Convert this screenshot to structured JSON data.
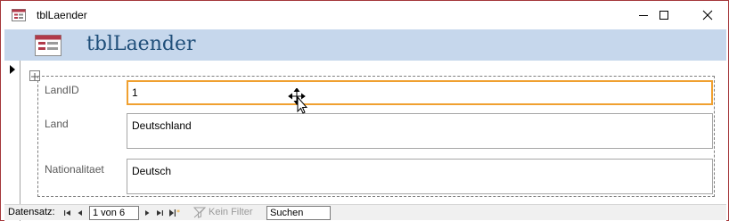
{
  "window": {
    "title": "tblLaender",
    "icon": "table-form-icon",
    "controls": [
      "minimize",
      "maximize",
      "close"
    ]
  },
  "header": {
    "title": "tblLaender",
    "icon": "table-form-icon"
  },
  "fields": [
    {
      "label": "LandID",
      "value": "1",
      "active": true
    },
    {
      "label": "Land",
      "value": "Deutschland",
      "active": false
    },
    {
      "label": "Nationalitaet",
      "value": "Deutsch",
      "active": false
    }
  ],
  "navigation": {
    "label": "Datensatz:",
    "record": "1 von 6",
    "filter_label": "Kein Filter",
    "search_placeholder": "Suchen"
  },
  "colors": {
    "header_band": "#c6d7ec",
    "header_title": "#1f4e79",
    "active_border": "#f0a030",
    "window_border": "#a4373a"
  }
}
